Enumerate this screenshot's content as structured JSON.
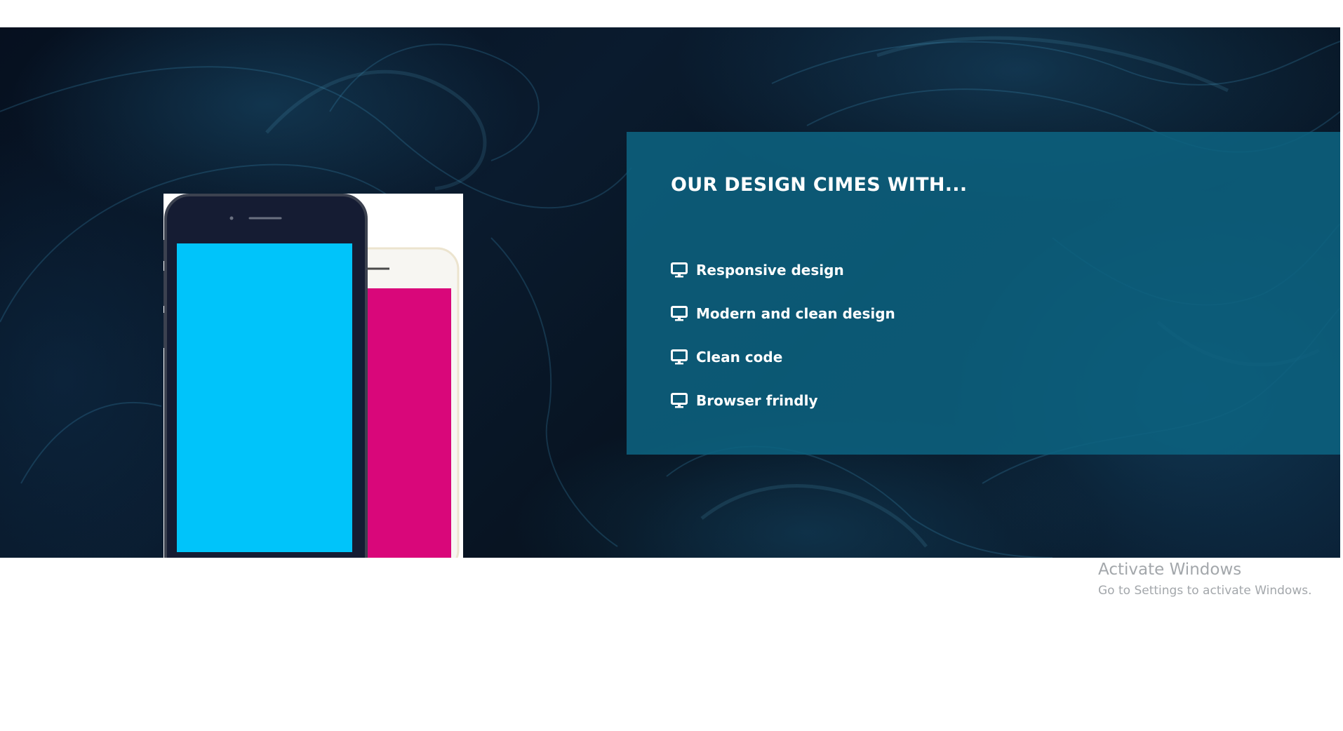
{
  "panel": {
    "title": "OUR DESIGN CIMES WITH...",
    "background_color": "#0d6280"
  },
  "features": [
    {
      "label": "Responsive design",
      "icon": "monitor-icon"
    },
    {
      "label": "Modern and clean design",
      "icon": "monitor-icon"
    },
    {
      "label": "Clean code",
      "icon": "monitor-icon"
    },
    {
      "label": "Browser frindly",
      "icon": "monitor-icon"
    }
  ],
  "phones": {
    "front_screen_color": "#00c4fa",
    "back_screen_color": "#d9077a"
  },
  "activation": {
    "title": "Activate Windows",
    "subtitle": "Go to Settings to activate Windows."
  }
}
